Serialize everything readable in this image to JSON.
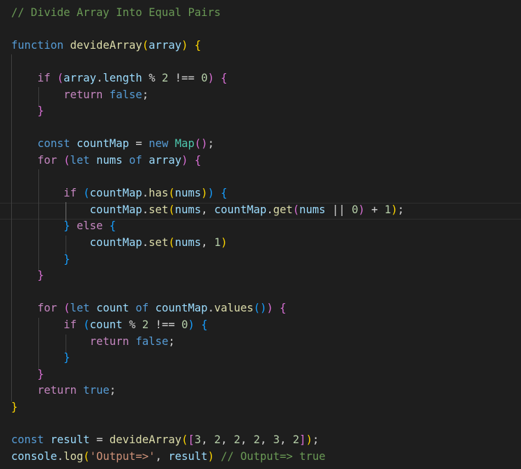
{
  "theme": {
    "background": "#1e1e1e",
    "current_line_border": "#2f2f2f",
    "indent_guide": "#404040",
    "indent_guide_active": "#707070"
  },
  "colors": {
    "comment": "#6a9955",
    "keyword": "#569cd6",
    "control": "#c586c0",
    "function": "#dcdcaa",
    "variable": "#9cdcfe",
    "class": "#4ec9b0",
    "number": "#b5cea8",
    "string": "#ce9178",
    "text": "#d4d4d4",
    "bracket1": "#ffd700",
    "bracket2": "#da70d6",
    "bracket3": "#179fff"
  },
  "code": {
    "lines": [
      [
        [
          "comment",
          "// Divide Array Into Equal Pairs"
        ]
      ],
      [],
      [
        [
          "keyword",
          "function"
        ],
        [
          "text",
          " "
        ],
        [
          "function",
          "devideArray"
        ],
        [
          "bracket1",
          "("
        ],
        [
          "variable",
          "array"
        ],
        [
          "bracket1",
          ")"
        ],
        [
          "text",
          " "
        ],
        [
          "bracket1",
          "{"
        ]
      ],
      [],
      [
        [
          "text",
          "    "
        ],
        [
          "control",
          "if"
        ],
        [
          "text",
          " "
        ],
        [
          "bracket2",
          "("
        ],
        [
          "variable",
          "array"
        ],
        [
          "text",
          "."
        ],
        [
          "variable",
          "length"
        ],
        [
          "text",
          " % "
        ],
        [
          "number",
          "2"
        ],
        [
          "text",
          " !== "
        ],
        [
          "number",
          "0"
        ],
        [
          "bracket2",
          ")"
        ],
        [
          "text",
          " "
        ],
        [
          "bracket2",
          "{"
        ]
      ],
      [
        [
          "text",
          "        "
        ],
        [
          "control",
          "return"
        ],
        [
          "text",
          " "
        ],
        [
          "keyword",
          "false"
        ],
        [
          "text",
          ";"
        ]
      ],
      [
        [
          "text",
          "    "
        ],
        [
          "bracket2",
          "}"
        ]
      ],
      [],
      [
        [
          "text",
          "    "
        ],
        [
          "keyword",
          "const"
        ],
        [
          "text",
          " "
        ],
        [
          "variable",
          "countMap"
        ],
        [
          "text",
          " = "
        ],
        [
          "keyword",
          "new"
        ],
        [
          "text",
          " "
        ],
        [
          "class",
          "Map"
        ],
        [
          "bracket2",
          "()"
        ],
        [
          "text",
          ";"
        ]
      ],
      [
        [
          "text",
          "    "
        ],
        [
          "control",
          "for"
        ],
        [
          "text",
          " "
        ],
        [
          "bracket2",
          "("
        ],
        [
          "keyword",
          "let"
        ],
        [
          "text",
          " "
        ],
        [
          "variable",
          "nums"
        ],
        [
          "text",
          " "
        ],
        [
          "keyword",
          "of"
        ],
        [
          "text",
          " "
        ],
        [
          "variable",
          "array"
        ],
        [
          "bracket2",
          ")"
        ],
        [
          "text",
          " "
        ],
        [
          "bracket2",
          "{"
        ]
      ],
      [],
      [
        [
          "text",
          "        "
        ],
        [
          "control",
          "if"
        ],
        [
          "text",
          " "
        ],
        [
          "bracket3",
          "("
        ],
        [
          "variable",
          "countMap"
        ],
        [
          "text",
          "."
        ],
        [
          "function",
          "has"
        ],
        [
          "bracket1",
          "("
        ],
        [
          "variable",
          "nums"
        ],
        [
          "bracket1",
          ")"
        ],
        [
          "bracket3",
          ")"
        ],
        [
          "text",
          " "
        ],
        [
          "bracket3",
          "{"
        ]
      ],
      [
        [
          "text",
          "            "
        ],
        [
          "variable",
          "countMap"
        ],
        [
          "text",
          "."
        ],
        [
          "function",
          "set"
        ],
        [
          "bracket1",
          "("
        ],
        [
          "variable",
          "nums"
        ],
        [
          "text",
          ", "
        ],
        [
          "variable",
          "countMap"
        ],
        [
          "text",
          "."
        ],
        [
          "function",
          "get"
        ],
        [
          "bracket2",
          "("
        ],
        [
          "variable",
          "nums"
        ],
        [
          "text",
          " || "
        ],
        [
          "number",
          "0"
        ],
        [
          "bracket2",
          ")"
        ],
        [
          "text",
          " + "
        ],
        [
          "number",
          "1"
        ],
        [
          "bracket1",
          ")"
        ],
        [
          "text",
          ";"
        ]
      ],
      [
        [
          "text",
          "        "
        ],
        [
          "bracket3",
          "}"
        ],
        [
          "text",
          " "
        ],
        [
          "control",
          "else"
        ],
        [
          "text",
          " "
        ],
        [
          "bracket3",
          "{"
        ]
      ],
      [
        [
          "text",
          "            "
        ],
        [
          "variable",
          "countMap"
        ],
        [
          "text",
          "."
        ],
        [
          "function",
          "set"
        ],
        [
          "bracket1",
          "("
        ],
        [
          "variable",
          "nums"
        ],
        [
          "text",
          ", "
        ],
        [
          "number",
          "1"
        ],
        [
          "bracket1",
          ")"
        ]
      ],
      [
        [
          "text",
          "        "
        ],
        [
          "bracket3",
          "}"
        ]
      ],
      [
        [
          "text",
          "    "
        ],
        [
          "bracket2",
          "}"
        ]
      ],
      [],
      [
        [
          "text",
          "    "
        ],
        [
          "control",
          "for"
        ],
        [
          "text",
          " "
        ],
        [
          "bracket2",
          "("
        ],
        [
          "keyword",
          "let"
        ],
        [
          "text",
          " "
        ],
        [
          "variable",
          "count"
        ],
        [
          "text",
          " "
        ],
        [
          "keyword",
          "of"
        ],
        [
          "text",
          " "
        ],
        [
          "variable",
          "countMap"
        ],
        [
          "text",
          "."
        ],
        [
          "function",
          "values"
        ],
        [
          "bracket3",
          "()"
        ],
        [
          "bracket2",
          ")"
        ],
        [
          "text",
          " "
        ],
        [
          "bracket2",
          "{"
        ]
      ],
      [
        [
          "text",
          "        "
        ],
        [
          "control",
          "if"
        ],
        [
          "text",
          " "
        ],
        [
          "bracket3",
          "("
        ],
        [
          "variable",
          "count"
        ],
        [
          "text",
          " % "
        ],
        [
          "number",
          "2"
        ],
        [
          "text",
          " !== "
        ],
        [
          "number",
          "0"
        ],
        [
          "bracket3",
          ")"
        ],
        [
          "text",
          " "
        ],
        [
          "bracket3",
          "{"
        ]
      ],
      [
        [
          "text",
          "            "
        ],
        [
          "control",
          "return"
        ],
        [
          "text",
          " "
        ],
        [
          "keyword",
          "false"
        ],
        [
          "text",
          ";"
        ]
      ],
      [
        [
          "text",
          "        "
        ],
        [
          "bracket3",
          "}"
        ]
      ],
      [
        [
          "text",
          "    "
        ],
        [
          "bracket2",
          "}"
        ]
      ],
      [
        [
          "text",
          "    "
        ],
        [
          "control",
          "return"
        ],
        [
          "text",
          " "
        ],
        [
          "keyword",
          "true"
        ],
        [
          "text",
          ";"
        ]
      ],
      [
        [
          "bracket1",
          "}"
        ]
      ],
      [],
      [
        [
          "keyword",
          "const"
        ],
        [
          "text",
          " "
        ],
        [
          "variable",
          "result"
        ],
        [
          "text",
          " = "
        ],
        [
          "function",
          "devideArray"
        ],
        [
          "bracket1",
          "("
        ],
        [
          "bracket2",
          "["
        ],
        [
          "number",
          "3"
        ],
        [
          "text",
          ", "
        ],
        [
          "number",
          "2"
        ],
        [
          "text",
          ", "
        ],
        [
          "number",
          "2"
        ],
        [
          "text",
          ", "
        ],
        [
          "number",
          "2"
        ],
        [
          "text",
          ", "
        ],
        [
          "number",
          "3"
        ],
        [
          "text",
          ", "
        ],
        [
          "number",
          "2"
        ],
        [
          "bracket2",
          "]"
        ],
        [
          "bracket1",
          ")"
        ],
        [
          "text",
          ";"
        ]
      ],
      [
        [
          "variable",
          "console"
        ],
        [
          "text",
          "."
        ],
        [
          "function",
          "log"
        ],
        [
          "bracket1",
          "("
        ],
        [
          "string",
          "'Output=>'"
        ],
        [
          "text",
          ", "
        ],
        [
          "variable",
          "result"
        ],
        [
          "bracket1",
          ")"
        ],
        [
          "text",
          " "
        ],
        [
          "comment",
          "// Output=> true"
        ]
      ]
    ]
  }
}
